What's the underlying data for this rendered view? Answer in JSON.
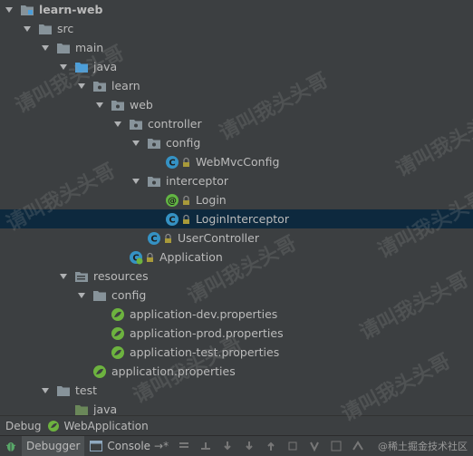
{
  "tree": [
    {
      "label": "learn-web",
      "depth": 0,
      "icon": "module-folder-icon",
      "expanded": true,
      "bold": true
    },
    {
      "label": "src",
      "depth": 1,
      "icon": "folder-icon",
      "expanded": true
    },
    {
      "label": "main",
      "depth": 2,
      "icon": "folder-icon",
      "expanded": true
    },
    {
      "label": "java",
      "depth": 3,
      "icon": "source-folder-icon",
      "expanded": true
    },
    {
      "label": "learn",
      "depth": 4,
      "icon": "package-icon",
      "expanded": true
    },
    {
      "label": "web",
      "depth": 5,
      "icon": "package-icon",
      "expanded": true
    },
    {
      "label": "controller",
      "depth": 6,
      "icon": "package-icon",
      "expanded": true
    },
    {
      "label": "config",
      "depth": 7,
      "icon": "package-icon",
      "expanded": true
    },
    {
      "label": "WebMvcConfig",
      "depth": 8,
      "icon": "java-class-icon",
      "lock": true
    },
    {
      "label": "interceptor",
      "depth": 7,
      "icon": "package-icon",
      "expanded": true
    },
    {
      "label": "Login",
      "depth": 8,
      "icon": "annotation-icon",
      "lock": true
    },
    {
      "label": "LoginInterceptor",
      "depth": 8,
      "icon": "java-class-icon",
      "lock": true,
      "selected": true
    },
    {
      "label": "UserController",
      "depth": 7,
      "icon": "java-class-icon",
      "lock": true
    },
    {
      "label": "Application",
      "depth": 6,
      "icon": "spring-boot-class-icon",
      "lock": true
    },
    {
      "label": "resources",
      "depth": 3,
      "icon": "resources-folder-icon",
      "expanded": true
    },
    {
      "label": "config",
      "depth": 4,
      "icon": "folder-icon",
      "expanded": true
    },
    {
      "label": "application-dev.properties",
      "depth": 5,
      "icon": "spring-properties-icon"
    },
    {
      "label": "application-prod.properties",
      "depth": 5,
      "icon": "spring-properties-icon"
    },
    {
      "label": "application-test.properties",
      "depth": 5,
      "icon": "spring-properties-icon"
    },
    {
      "label": "application.properties",
      "depth": 4,
      "icon": "spring-properties-icon"
    },
    {
      "label": "test",
      "depth": 2,
      "icon": "folder-icon",
      "expanded": true
    },
    {
      "label": "java",
      "depth": 3,
      "icon": "test-source-folder-icon"
    }
  ],
  "debug_bar": {
    "debug_label": "Debug",
    "config_label": "WebApplication"
  },
  "toolbar": {
    "debugger_tab": "Debugger",
    "console_tab": "Console"
  },
  "watermark": {
    "text": "请叫我头头哥",
    "site": "@稀土掘金技术社区"
  },
  "colors": {
    "background": "#3c3f41",
    "selection": "#0d293e",
    "folder": "#87939a",
    "source_folder": "#4c9ed9",
    "class_icon": "#3592c4",
    "spring_green": "#6db33f"
  }
}
